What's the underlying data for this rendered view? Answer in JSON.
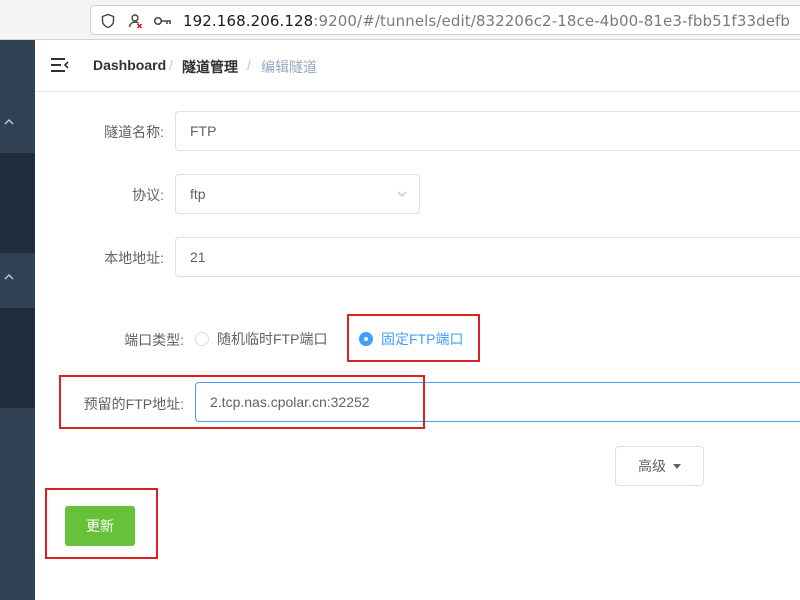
{
  "browser": {
    "url_host": "192.168.206.128",
    "url_rest": ":9200/#/tunnels/edit/832206c2-18ce-4b00-81e3-fbb51f33defb"
  },
  "breadcrumb": {
    "items": [
      "Dashboard",
      "隧道管理",
      "编辑隧道"
    ],
    "separator": "/"
  },
  "form": {
    "tunnel_name": {
      "label": "隧道名称:",
      "value": "FTP"
    },
    "protocol": {
      "label": "协议:",
      "value": "ftp"
    },
    "local_address": {
      "label": "本地地址:",
      "value": "21"
    },
    "port_type": {
      "label": "端口类型:",
      "options": [
        "随机临时FTP端口",
        "固定FTP端口"
      ],
      "selected": "固定FTP端口"
    },
    "reserved_ftp_address": {
      "label": "预留的FTP地址:",
      "value": "2.tcp.nas.cpolar.cn:32252"
    }
  },
  "buttons": {
    "advanced": "高级",
    "update": "更新"
  },
  "colors": {
    "sidebar": "#304156",
    "primary": "#409eff",
    "success": "#67c23a",
    "highlight": "#e02020"
  }
}
